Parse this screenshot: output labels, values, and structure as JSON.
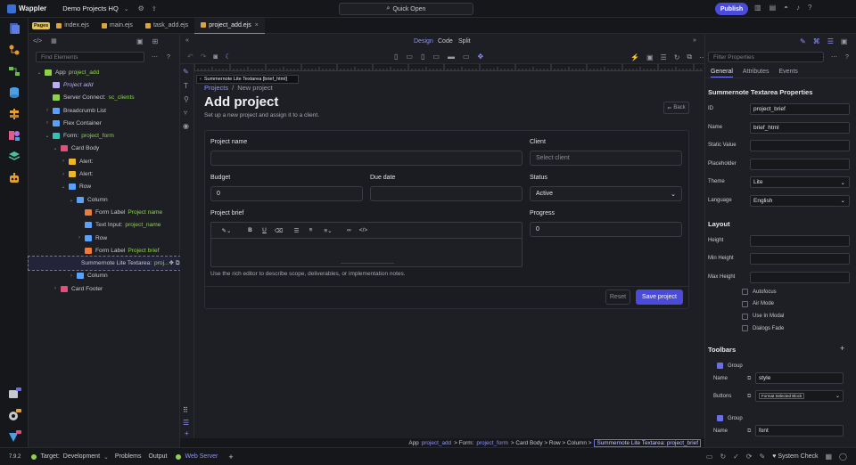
{
  "app": {
    "brand": "Wappler",
    "project": "Demo Projects HQ",
    "quick_open": "Quick Open",
    "publish": "Publish"
  },
  "tabs": {
    "badge": "Pages",
    "items": [
      "index.ejs",
      "main.ejs",
      "task_add.ejs",
      "project_add.ejs"
    ]
  },
  "structure": {
    "find_placeholder": "Find Elements",
    "nodes": [
      {
        "label": "App",
        "hl": "project_add",
        "indent": 0,
        "caret": "v",
        "color": "#8fd14f"
      },
      {
        "label": "Project add",
        "hl": "",
        "indent": 1,
        "caret": "",
        "color": "#b8b0f0",
        "italic": true
      },
      {
        "label": "Server Connect:",
        "hl": "sc_clients",
        "indent": 1,
        "caret": "",
        "color": "#8fd14f"
      },
      {
        "label": "Breadcrumb List",
        "hl": "",
        "indent": 1,
        "caret": ">",
        "color": "#5aa0ff"
      },
      {
        "label": "Flex Container",
        "hl": "",
        "indent": 1,
        "caret": ">",
        "color": "#5aa0ff"
      },
      {
        "label": "Form:",
        "hl": "project_form",
        "indent": 1,
        "caret": "v",
        "color": "#2ec4b6"
      },
      {
        "label": "Card Body",
        "hl": "",
        "indent": 2,
        "caret": "v",
        "color": "#e0507a"
      },
      {
        "label": "Alert:",
        "hl": "",
        "indent": 3,
        "caret": ">",
        "color": "#f0b429"
      },
      {
        "label": "Alert:",
        "hl": "",
        "indent": 3,
        "caret": ">",
        "color": "#f0b429"
      },
      {
        "label": "Row",
        "hl": "",
        "indent": 3,
        "caret": "v",
        "color": "#5aa0ff"
      },
      {
        "label": "Column",
        "hl": "",
        "indent": 4,
        "caret": "v",
        "color": "#5aa0ff"
      },
      {
        "label": "Form Label",
        "hl": "Project name",
        "indent": 5,
        "caret": "",
        "color": "#f07a3a"
      },
      {
        "label": "Text Input:",
        "hl": "project_name",
        "indent": 5,
        "caret": "",
        "color": "#5aa0ff"
      },
      {
        "label": "Row",
        "hl": "",
        "indent": 5,
        "caret": ">",
        "color": "#5aa0ff"
      },
      {
        "label": "Form Label",
        "hl": "Project brief",
        "indent": 5,
        "caret": "",
        "color": "#f07a3a"
      },
      {
        "label": "Summernote Lite Textarea:",
        "hl": "proj...",
        "indent": 5,
        "caret": "",
        "color": "#8fd14f",
        "selected": true
      },
      {
        "label": "Column",
        "hl": "",
        "indent": 4,
        "caret": ">",
        "color": "#5aa0ff"
      },
      {
        "label": "Card Footer",
        "hl": "",
        "indent": 2,
        "caret": ">",
        "color": "#e0507a"
      }
    ]
  },
  "viewbar": {
    "design": "Design",
    "code": "Code",
    "split": "Split"
  },
  "canvas": {
    "tooltip": "Summernote Lite Textarea [brief_html]",
    "crumb_projects": "Projects",
    "crumb_sep": "/",
    "crumb_new": "New project",
    "title": "Add project",
    "subtitle": "Set up a new project and assign it to a client.",
    "back": "Back",
    "project_name_label": "Project name",
    "client_label": "Client",
    "client_placeholder": "Select client",
    "budget_label": "Budget",
    "budget_value": "0",
    "due_label": "Due date",
    "status_label": "Status",
    "status_value": "Active",
    "brief_label": "Project brief",
    "progress_label": "Progress",
    "progress_value": "0",
    "hint": "Use the rich editor to describe scope, deliverables, or implementation notes.",
    "reset": "Reset",
    "save": "Save project"
  },
  "breadcrumb_bar": {
    "app": "App",
    "app_id": "project_add",
    "form": "Form:",
    "form_id": "project_form",
    "path": "Card Body > Row > Column >",
    "current": "Summernote Lite Textarea: project_brief"
  },
  "props": {
    "filter_placeholder": "Filter Properties",
    "tabs": [
      "General",
      "Attributes",
      "Events"
    ],
    "title": "Summernote Textarea Properties",
    "fields": [
      {
        "label": "ID",
        "value": "project_brief"
      },
      {
        "label": "Name",
        "value": "brief_html"
      },
      {
        "label": "Static Value",
        "value": ""
      },
      {
        "label": "Placeholder",
        "value": ""
      },
      {
        "label": "Theme",
        "value": "Lite",
        "select": true
      },
      {
        "label": "Language",
        "value": "English",
        "select": true
      }
    ],
    "layout_title": "Layout",
    "layout_fields": [
      {
        "label": "Height",
        "value": ""
      },
      {
        "label": "Min Height",
        "value": ""
      },
      {
        "label": "Max Height",
        "value": ""
      }
    ],
    "checks": [
      "Autofocus",
      "Air Mode",
      "Use In Modal",
      "Dialogs Fade"
    ],
    "toolbars_title": "Toolbars",
    "group_label": "Group",
    "name_label": "Name",
    "buttons_label": "Buttons",
    "group1_name": "style",
    "group1_button": "Format Selected Block",
    "group2_name": "font"
  },
  "status": {
    "version": "7.9.2",
    "target": "Target:",
    "target_value": "Development",
    "problems": "Problems",
    "output": "Output",
    "web_server": "Web Server",
    "system_check": "System Check"
  }
}
